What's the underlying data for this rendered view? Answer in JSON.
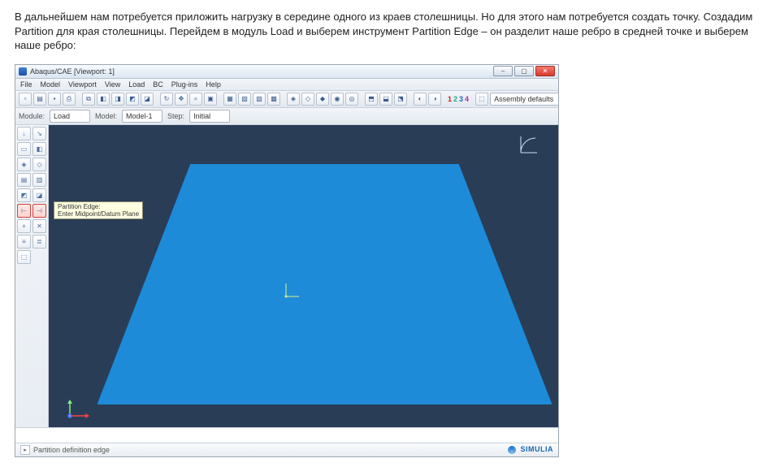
{
  "instruction": "В дальнейшем нам потребуется приложить нагрузку в середине одного из краев столешницы. Но для этого нам потребуется создать точку. Создадим Partition для края столешницы. Перейдем в модуль Load и выберем инструмент Partition Edge – он разделит наше ребро в средней точке и выберем наше ребро:",
  "app": {
    "title": "Abaqus/CAE [Viewport: 1]",
    "menu": [
      "File",
      "Model",
      "Viewport",
      "View",
      "Load",
      "BC",
      "Plug-ins",
      "Help"
    ],
    "context": {
      "module_label": "Module:",
      "module_value": "Load",
      "model_label": "Model:",
      "model_value": "Model-1",
      "step_label": "Step:",
      "step_value": "Initial"
    },
    "assembly_defaults": "Assembly defaults",
    "tooltip": "Partition Edge:\nEnter Midpoint/Datum Plane",
    "status": "Partition definition edge",
    "brand": "SIMULIA"
  }
}
